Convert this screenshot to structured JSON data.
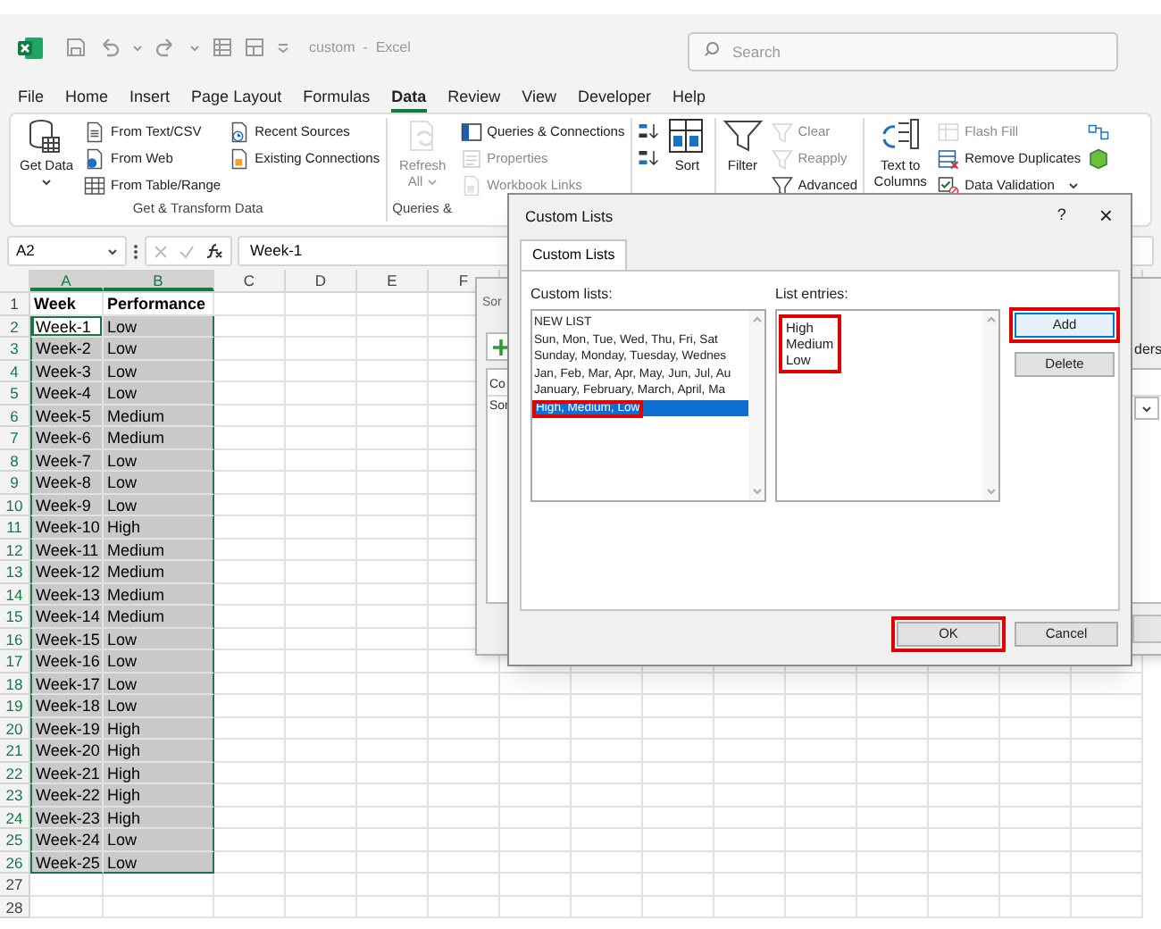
{
  "window": {
    "title": "custom  -  Excel"
  },
  "search": {
    "placeholder": "Search"
  },
  "menu_tabs": [
    {
      "label": "File",
      "selected": false
    },
    {
      "label": "Home",
      "selected": false
    },
    {
      "label": "Insert",
      "selected": false
    },
    {
      "label": "Page Layout",
      "selected": false
    },
    {
      "label": "Formulas",
      "selected": false
    },
    {
      "label": "Data",
      "selected": true
    },
    {
      "label": "Review",
      "selected": false
    },
    {
      "label": "View",
      "selected": false
    },
    {
      "label": "Developer",
      "selected": false
    },
    {
      "label": "Help",
      "selected": false
    }
  ],
  "ribbon": {
    "groups": [
      {
        "label": "Get & Transform Data",
        "columns": [
          [
            {
              "kind": "large",
              "label": "Get Data",
              "caret": true,
              "disabled": false
            }
          ],
          [
            {
              "kind": "small",
              "label": "From Text/CSV",
              "disabled": false
            },
            {
              "kind": "small",
              "label": "From Web",
              "disabled": false
            },
            {
              "kind": "small",
              "label": "From Table/Range",
              "disabled": false
            }
          ],
          [
            {
              "kind": "small",
              "label": "Recent Sources",
              "disabled": false
            },
            {
              "kind": "small",
              "label": "Existing Connections",
              "disabled": false
            }
          ]
        ]
      },
      {
        "label": "Queries &",
        "columns": [
          [
            {
              "kind": "large",
              "label": "Refresh All",
              "caret": true,
              "disabled": true
            }
          ],
          [
            {
              "kind": "small",
              "label": "Queries & Connections",
              "disabled": false
            },
            {
              "kind": "small",
              "label": "Properties",
              "disabled": true
            },
            {
              "kind": "small",
              "label": "Workbook Links",
              "disabled": true
            }
          ]
        ]
      },
      {
        "columns": [
          [
            {
              "kind": "small",
              "disabled": false
            },
            {
              "kind": "small",
              "disabled": false
            }
          ],
          [
            {
              "kind": "large",
              "label": "Sort",
              "disabled": false
            }
          ]
        ]
      },
      {
        "columns": [
          [
            {
              "kind": "large",
              "label": "Filter",
              "disabled": false
            }
          ],
          [
            {
              "kind": "small",
              "label": "Clear",
              "disabled": true
            },
            {
              "kind": "small",
              "label": "Reapply",
              "disabled": true
            },
            {
              "kind": "small",
              "label": "Advanced",
              "disabled": false
            }
          ]
        ]
      },
      {
        "columns": [
          [
            {
              "kind": "large",
              "label": "Text to Columns",
              "disabled": false
            }
          ],
          [
            {
              "kind": "small",
              "label": "Flash Fill",
              "disabled": true
            },
            {
              "kind": "small",
              "label": "Remove Duplicates",
              "disabled": false
            },
            {
              "kind": "small",
              "label": "Data Validation",
              "caret": true,
              "disabled": false
            }
          ],
          [
            {
              "kind": "small",
              "disabled": false
            },
            {
              "kind": "small",
              "disabled": false
            }
          ]
        ]
      }
    ]
  },
  "formula_bar": {
    "name_box": "A2",
    "formula": "Week-1"
  },
  "sheet": {
    "columns": [
      {
        "label": "A",
        "selected": true
      },
      {
        "label": "B",
        "selected": true
      },
      {
        "label": "C",
        "selected": false
      },
      {
        "label": "D",
        "selected": false
      },
      {
        "label": "E",
        "selected": false
      },
      {
        "label": "F",
        "selected": false
      }
    ],
    "rows": [
      {
        "number": "1",
        "selected": false,
        "cells": [
          {
            "text": "Week",
            "active": false
          },
          {
            "text": "Performance",
            "active": false
          }
        ]
      },
      {
        "number": "2",
        "selected": true,
        "cells": [
          {
            "text": "Week-1",
            "active": true
          },
          {
            "text": "Low",
            "active": false
          }
        ]
      },
      {
        "number": "3",
        "selected": true,
        "cells": [
          {
            "text": "Week-2",
            "active": false
          },
          {
            "text": "Low",
            "active": false
          }
        ]
      },
      {
        "number": "4",
        "selected": true,
        "cells": [
          {
            "text": "Week-3",
            "active": false
          },
          {
            "text": "Low",
            "active": false
          }
        ]
      },
      {
        "number": "5",
        "selected": true,
        "cells": [
          {
            "text": "Week-4",
            "active": false
          },
          {
            "text": "Low",
            "active": false
          }
        ]
      },
      {
        "number": "6",
        "selected": true,
        "cells": [
          {
            "text": "Week-5",
            "active": false
          },
          {
            "text": "Medium",
            "active": false
          }
        ]
      },
      {
        "number": "7",
        "selected": true,
        "cells": [
          {
            "text": "Week-6",
            "active": false
          },
          {
            "text": "Medium",
            "active": false
          }
        ]
      },
      {
        "number": "8",
        "selected": true,
        "cells": [
          {
            "text": "Week-7",
            "active": false
          },
          {
            "text": "Low",
            "active": false
          }
        ]
      },
      {
        "number": "9",
        "selected": true,
        "cells": [
          {
            "text": "Week-8",
            "active": false
          },
          {
            "text": "Low",
            "active": false
          }
        ]
      },
      {
        "number": "10",
        "selected": true,
        "cells": [
          {
            "text": "Week-9",
            "active": false
          },
          {
            "text": "Low",
            "active": false
          }
        ]
      },
      {
        "number": "11",
        "selected": true,
        "cells": [
          {
            "text": "Week-10",
            "active": false
          },
          {
            "text": "High",
            "active": false
          }
        ]
      },
      {
        "number": "12",
        "selected": true,
        "cells": [
          {
            "text": "Week-11",
            "active": false
          },
          {
            "text": "Medium",
            "active": false
          }
        ]
      },
      {
        "number": "13",
        "selected": true,
        "cells": [
          {
            "text": "Week-12",
            "active": false
          },
          {
            "text": "Medium",
            "active": false
          }
        ]
      },
      {
        "number": "14",
        "selected": true,
        "cells": [
          {
            "text": "Week-13",
            "active": false
          },
          {
            "text": "Medium",
            "active": false
          }
        ]
      },
      {
        "number": "15",
        "selected": true,
        "cells": [
          {
            "text": "Week-14",
            "active": false
          },
          {
            "text": "Medium",
            "active": false
          }
        ]
      },
      {
        "number": "16",
        "selected": true,
        "cells": [
          {
            "text": "Week-15",
            "active": false
          },
          {
            "text": "Low",
            "active": false
          }
        ]
      },
      {
        "number": "17",
        "selected": true,
        "cells": [
          {
            "text": "Week-16",
            "active": false
          },
          {
            "text": "Low",
            "active": false
          }
        ]
      },
      {
        "number": "18",
        "selected": true,
        "cells": [
          {
            "text": "Week-17",
            "active": false
          },
          {
            "text": "Low",
            "active": false
          }
        ]
      },
      {
        "number": "19",
        "selected": true,
        "cells": [
          {
            "text": "Week-18",
            "active": false
          },
          {
            "text": "Low",
            "active": false
          }
        ]
      },
      {
        "number": "20",
        "selected": true,
        "cells": [
          {
            "text": "Week-19",
            "active": false
          },
          {
            "text": "High",
            "active": false
          }
        ]
      },
      {
        "number": "21",
        "selected": true,
        "cells": [
          {
            "text": "Week-20",
            "active": false
          },
          {
            "text": "High",
            "active": false
          }
        ]
      },
      {
        "number": "22",
        "selected": true,
        "cells": [
          {
            "text": "Week-21",
            "active": false
          },
          {
            "text": "High",
            "active": false
          }
        ]
      },
      {
        "number": "23",
        "selected": true,
        "cells": [
          {
            "text": "Week-22",
            "active": false
          },
          {
            "text": "High",
            "active": false
          }
        ]
      },
      {
        "number": "24",
        "selected": true,
        "cells": [
          {
            "text": "Week-23",
            "active": false
          },
          {
            "text": "High",
            "active": false
          }
        ]
      },
      {
        "number": "25",
        "selected": true,
        "cells": [
          {
            "text": "Week-24",
            "active": false
          },
          {
            "text": "Low",
            "active": false
          }
        ]
      },
      {
        "number": "26",
        "selected": true,
        "cells": [
          {
            "text": "Week-25",
            "active": false
          },
          {
            "text": "Low",
            "active": false
          }
        ]
      },
      {
        "number": "27",
        "selected": false
      },
      {
        "number": "28",
        "selected": false
      }
    ]
  },
  "sort_dialog": {
    "title": "Sor",
    "column_label": "Co",
    "row_label": "Sor",
    "headers_label": "ders"
  },
  "custom_lists_dialog": {
    "title": "Custom Lists",
    "help": "?",
    "close": "×",
    "tabs": [
      {
        "label": "Custom Lists",
        "selected": true
      }
    ],
    "lists_label": "Custom lists:",
    "lists": [
      {
        "text": "NEW LIST",
        "selected": false,
        "marked": false
      },
      {
        "text": "Sun, Mon, Tue, Wed, Thu, Fri, Sat",
        "selected": false,
        "marked": false
      },
      {
        "text": "Sunday, Monday, Tuesday, Wednes",
        "selected": false,
        "marked": false
      },
      {
        "text": "Jan, Feb, Mar, Apr, May, Jun, Jul, Au",
        "selected": false,
        "marked": false
      },
      {
        "text": "January, February, March, April, Ma",
        "selected": false,
        "marked": false
      },
      {
        "text": "High, Medium, Low",
        "selected": true,
        "marked": true
      }
    ],
    "entries_label": "List entries:",
    "entries": {
      "marked": true,
      "lines": [
        "High",
        "Medium",
        "Low"
      ]
    },
    "side_buttons": [
      {
        "label": "Add",
        "marked": true,
        "focused": true
      },
      {
        "label": "Delete",
        "marked": false,
        "focused": false
      }
    ],
    "footer_buttons": [
      {
        "label": "OK",
        "marked": true
      },
      {
        "label": "Cancel",
        "marked": false
      }
    ]
  }
}
